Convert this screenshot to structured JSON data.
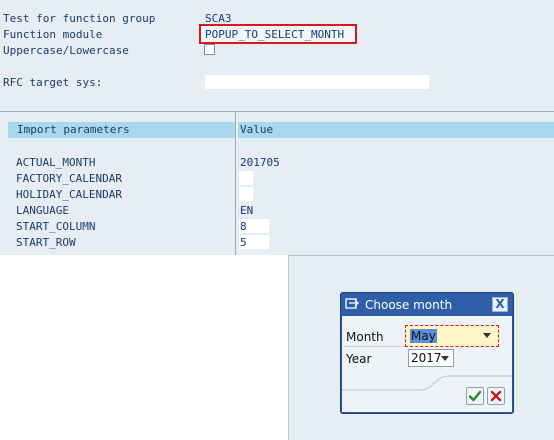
{
  "header": {
    "function_group_label": "Test for function group",
    "function_group_value": "SCA3",
    "function_module_label": "Function module",
    "function_module_value": "POPUP_TO_SELECT_MONTH",
    "case_label": "Uppercase/Lowercase",
    "rfc_label": "RFC target sys:",
    "rfc_value": ""
  },
  "table": {
    "col_import": "Import parameters",
    "col_value": "Value",
    "rows": [
      {
        "name": "ACTUAL_MONTH",
        "value": "201705"
      },
      {
        "name": "FACTORY_CALENDAR",
        "value": ""
      },
      {
        "name": "HOLIDAY_CALENDAR",
        "value": ""
      },
      {
        "name": "LANGUAGE",
        "value": "EN"
      },
      {
        "name": "START_COLUMN",
        "value": "8"
      },
      {
        "name": "START_ROW",
        "value": "5"
      }
    ]
  },
  "dialog": {
    "title": "Choose month",
    "close_glyph": "X",
    "month_label": "Month",
    "month_value": "May",
    "year_label": "Year",
    "year_value": "2017",
    "ok_icon": "checkmark-icon",
    "cancel_icon": "cancel-x-icon"
  },
  "colors": {
    "highlight_red": "#d6191e",
    "dialog_blue": "#2f5ea8",
    "table_header": "#a9d8ee"
  }
}
